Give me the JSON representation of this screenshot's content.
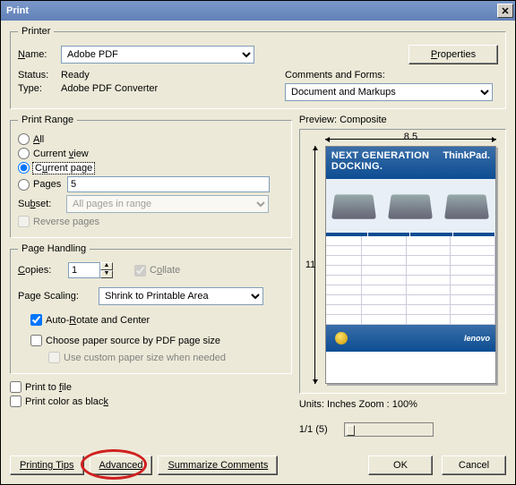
{
  "window": {
    "title": "Print"
  },
  "printer_group": {
    "legend": "Printer",
    "name_label": "Name:",
    "name_value": "Adobe PDF",
    "status_label": "Status:",
    "status_value": "Ready",
    "type_label": "Type:",
    "type_value": "Adobe PDF Converter",
    "properties_btn": "Properties",
    "comments_label": "Comments and Forms:",
    "comments_value": "Document and Markups"
  },
  "range_group": {
    "legend": "Print Range",
    "all": "All",
    "current_view": "Current view",
    "current_page": "Current page",
    "pages": "Pages",
    "pages_value": "5",
    "subset_label": "Subset:",
    "subset_value": "All pages in range",
    "reverse": "Reverse pages",
    "selected": "current_page"
  },
  "handling_group": {
    "legend": "Page Handling",
    "copies_label": "Copies:",
    "copies_value": "1",
    "collate": "Collate",
    "scaling_label": "Page Scaling:",
    "scaling_value": "Shrink to Printable Area",
    "auto_rotate": "Auto-Rotate and Center",
    "choose_source": "Choose paper source by PDF page size",
    "custom_paper": "Use custom paper size when needed"
  },
  "misc": {
    "print_to_file": "Print to file",
    "print_color_black": "Print color as black"
  },
  "preview": {
    "label": "Preview: Composite",
    "width": "8.5",
    "height": "11",
    "units_zoom": "Units: Inches Zoom : 100%",
    "page_info": "1/1 (5)",
    "doc_title": "NEXT GENERATION DOCKING.",
    "brand_a": "ThinkPad.",
    "brand_b": "lenovo"
  },
  "footer": {
    "printing_tips": "Printing Tips",
    "advanced": "Advanced",
    "summarize": "Summarize Comments",
    "ok": "OK",
    "cancel": "Cancel"
  }
}
